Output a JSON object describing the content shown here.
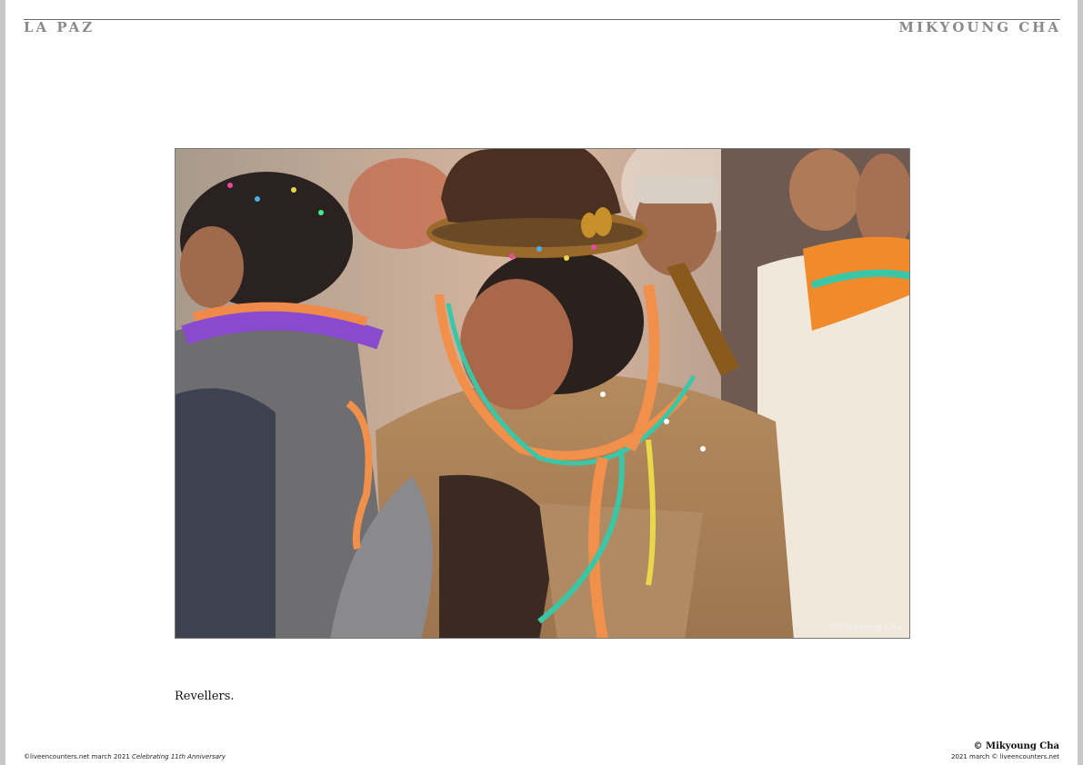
{
  "header": {
    "left_title": "LA PAZ",
    "right_title": "MIKYOUNG CHA"
  },
  "photo": {
    "credit": "©Mikyoung Cha"
  },
  "caption": "Revellers.",
  "footer": {
    "left_text": "©liveencounters.net march 2021 ",
    "left_italic": "Celebrating 11th Anniversary",
    "right_copyright": "© Mikyoung Cha",
    "right_text": "2021 march © liveencounters.net"
  }
}
